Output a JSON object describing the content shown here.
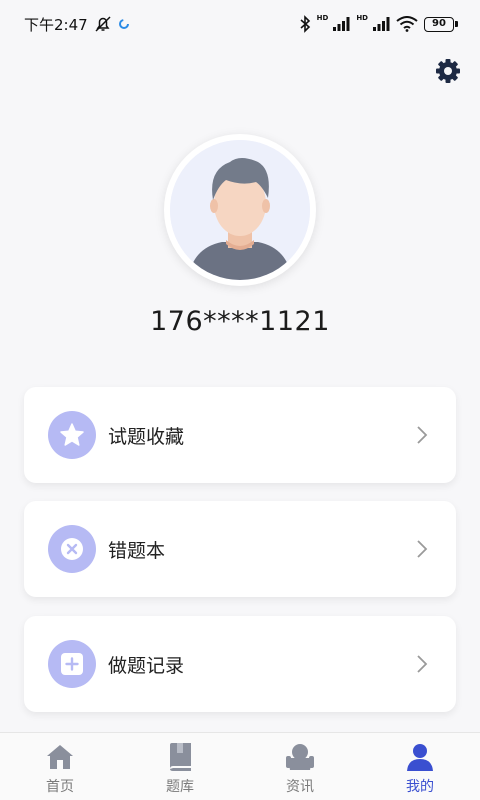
{
  "status_bar": {
    "time": "下午2:47",
    "battery": "90",
    "hd1": "HD",
    "hd2": "HD"
  },
  "profile": {
    "phone": "176****1121"
  },
  "menu": [
    {
      "label": "试题收藏",
      "icon": "star-icon"
    },
    {
      "label": "错题本",
      "icon": "x-circle-icon"
    },
    {
      "label": "做题记录",
      "icon": "plus-square-icon"
    }
  ],
  "tabs": [
    {
      "label": "首页",
      "icon": "home-icon",
      "active": false
    },
    {
      "label": "题库",
      "icon": "book-icon",
      "active": false
    },
    {
      "label": "资讯",
      "icon": "news-icon",
      "active": false
    },
    {
      "label": "我的",
      "icon": "user-icon",
      "active": true
    }
  ],
  "colors": {
    "accent": "#3a4fd0",
    "icon_circle": "#b6baf4",
    "inactive_icon": "#8a8f9c"
  }
}
